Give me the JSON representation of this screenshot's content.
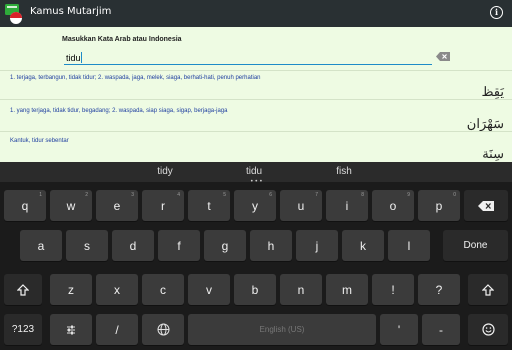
{
  "app": {
    "title": "Kamus Mutarjim",
    "info_icon": "info-icon",
    "logo_icon": "kamus-logo-icon"
  },
  "search": {
    "label": "Masukkan Kata Arab atau Indonesia",
    "value": "tidu",
    "clear_icon": "backspace-clear-icon"
  },
  "results": [
    {
      "definition": "1. terjaga, terbangun, tidak tidur; 2. waspada, jaga, melek, siaga, berhati-hati, penuh perhatian",
      "arabic": "يَقِظ"
    },
    {
      "definition": "1. yang terjaga, tidak tidur, begadang; 2. waspada, siap siaga, sigap, berjaga-jaga",
      "arabic": "سَهْرَان"
    },
    {
      "definition": "Kantuk, tidur sebentar",
      "arabic": "سِنَة"
    }
  ],
  "suggestions": [
    "tidy",
    "tidu",
    "fish"
  ],
  "suggestion_dots": "•••",
  "keyboard": {
    "row1": [
      {
        "label": "q",
        "hint": "1"
      },
      {
        "label": "w",
        "hint": "2"
      },
      {
        "label": "e",
        "hint": "3"
      },
      {
        "label": "r",
        "hint": "4"
      },
      {
        "label": "t",
        "hint": "5"
      },
      {
        "label": "y",
        "hint": "6"
      },
      {
        "label": "u",
        "hint": "7"
      },
      {
        "label": "i",
        "hint": "8"
      },
      {
        "label": "o",
        "hint": "9"
      },
      {
        "label": "p",
        "hint": "0"
      }
    ],
    "row2": [
      {
        "label": "a",
        "hint": ""
      },
      {
        "label": "s",
        "hint": ""
      },
      {
        "label": "d",
        "hint": ""
      },
      {
        "label": "f",
        "hint": ""
      },
      {
        "label": "g",
        "hint": ""
      },
      {
        "label": "h",
        "hint": ""
      },
      {
        "label": "j",
        "hint": ""
      },
      {
        "label": "k",
        "hint": ""
      },
      {
        "label": "l",
        "hint": ""
      }
    ],
    "row3": [
      {
        "label": "z",
        "hint": ""
      },
      {
        "label": "x",
        "hint": ""
      },
      {
        "label": "c",
        "hint": ""
      },
      {
        "label": "v",
        "hint": ""
      },
      {
        "label": "b",
        "hint": ""
      },
      {
        "label": "n",
        "hint": ""
      },
      {
        "label": "m",
        "hint": ""
      },
      {
        "label": "!",
        "hint": ""
      },
      {
        "label": "?",
        "hint": ""
      }
    ],
    "done_label": "Done",
    "numbers_label": "?123",
    "slash_label": "/",
    "space_label": "English (US)",
    "apostrophe_label": "'",
    "dash_label": "-",
    "shift_icon": "shift-icon",
    "backspace_icon": "backspace-icon",
    "settings_icon": "settings-slider-icon",
    "globe_icon": "globe-icon",
    "emoji_icon": "emoji-icon"
  }
}
